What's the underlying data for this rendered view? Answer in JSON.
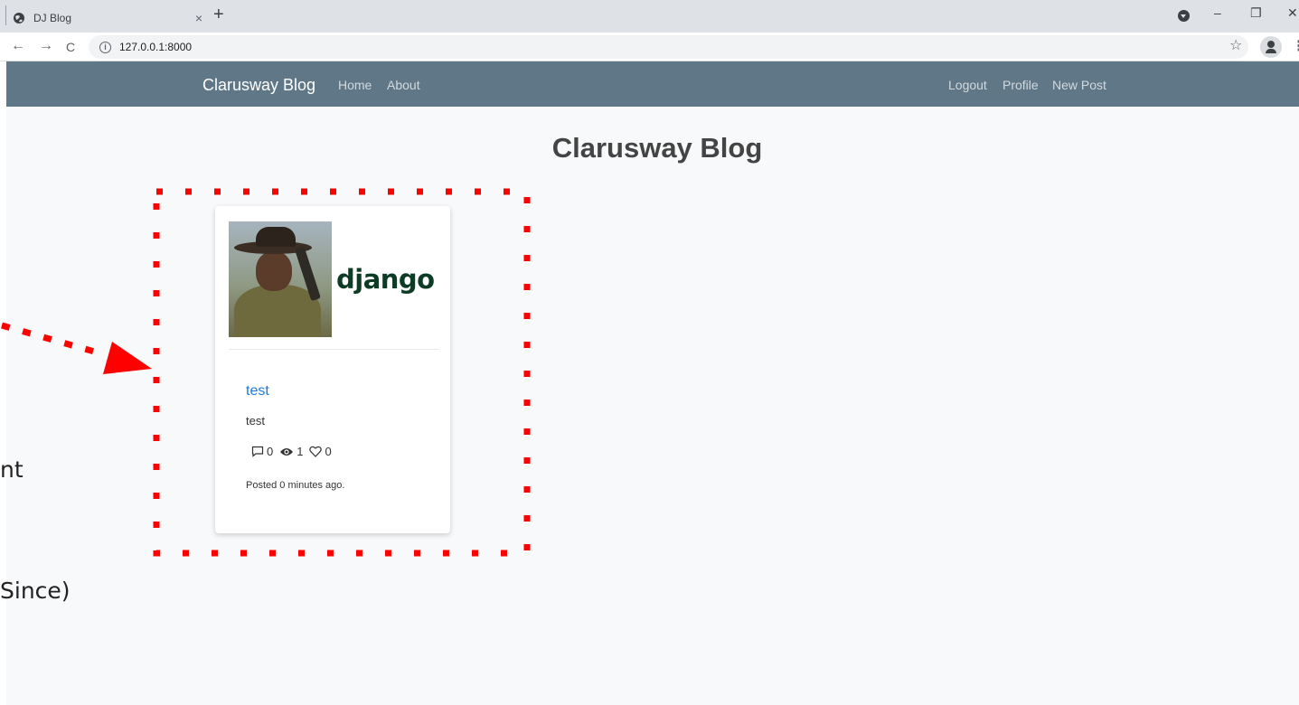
{
  "browser": {
    "tab_title": "DJ Blog",
    "tab_close": "×",
    "new_tab": "+",
    "url": "127.0.0.1:8000",
    "nav_back": "←",
    "nav_forward": "→",
    "nav_reload": "C",
    "info_badge": "i",
    "bookmark_star": "☆",
    "menu_glyph": "⋮",
    "window_minimize": "–",
    "window_restore": "❐",
    "window_close": "✕"
  },
  "navbar": {
    "brand": "Clarusway Blog",
    "left_links": [
      {
        "label": "Home"
      },
      {
        "label": "About"
      }
    ],
    "right_links": [
      {
        "label": "Logout"
      },
      {
        "label": "Profile"
      },
      {
        "label": "New Post"
      }
    ],
    "background": "#5f7787"
  },
  "page": {
    "title": "Clarusway Blog"
  },
  "post": {
    "image_logo_text": "django",
    "title": "test",
    "content": "test",
    "comments": "0",
    "views": "1",
    "likes": "0",
    "posted": "Posted 0 minutes ago.",
    "title_color": "#1d7be1"
  },
  "annotation": {
    "color": "#ff0000",
    "fragments": [
      "nt",
      "Since)"
    ]
  }
}
